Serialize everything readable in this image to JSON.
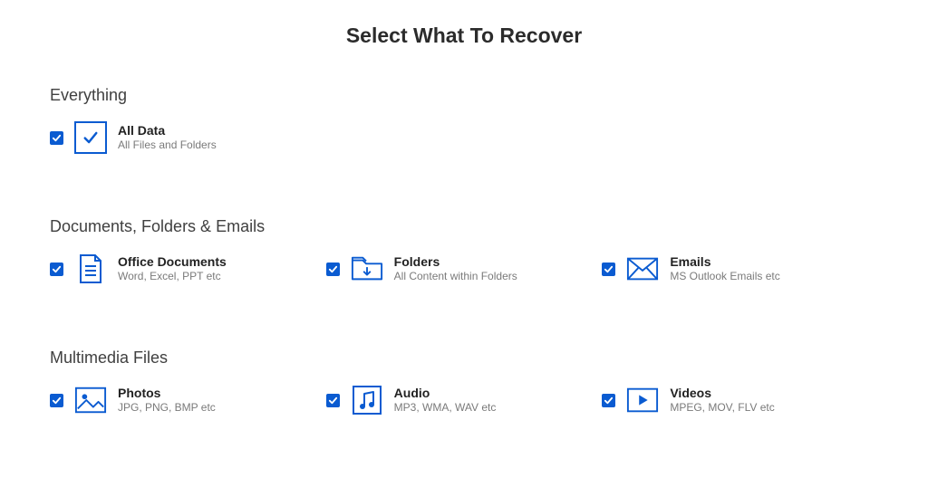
{
  "page_title": "Select What To Recover",
  "colors": {
    "accent": "#0a5bd1",
    "muted": "#7a7a7a"
  },
  "sections": {
    "everything": {
      "heading": "Everything",
      "all_data": {
        "title": "All Data",
        "desc": "All Files and Folders"
      }
    },
    "documents": {
      "heading": "Documents, Folders & Emails",
      "office": {
        "title": "Office Documents",
        "desc": "Word, Excel, PPT etc"
      },
      "folders": {
        "title": "Folders",
        "desc": "All Content within Folders"
      },
      "emails": {
        "title": "Emails",
        "desc": "MS Outlook Emails etc"
      }
    },
    "multimedia": {
      "heading": "Multimedia Files",
      "photos": {
        "title": "Photos",
        "desc": "JPG, PNG, BMP etc"
      },
      "audio": {
        "title": "Audio",
        "desc": "MP3, WMA, WAV etc"
      },
      "videos": {
        "title": "Videos",
        "desc": "MPEG, MOV, FLV etc"
      }
    }
  }
}
